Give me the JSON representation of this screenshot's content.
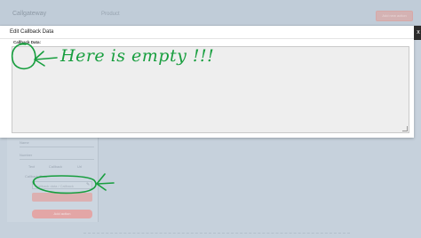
{
  "app": {
    "brand": "Callgateway",
    "page_heading": "Product",
    "top_button_label": "Add new action"
  },
  "background_form": {
    "field_1_label": "Name",
    "field_2_label": "Number",
    "tabs": [
      "Text",
      "Callback",
      "Url"
    ],
    "callback_label": "Callback Data",
    "callback_placeholder": "Callback data / Callback",
    "submit_label": "Add action"
  },
  "modal": {
    "title": "Edit Callback Data",
    "field_label": "Callback Data:",
    "textarea_value": "",
    "close_glyph": "x"
  },
  "annotation": {
    "text": "Here is empty !!!",
    "color": "#179e3e"
  },
  "colors": {
    "overlay": "#c6d1dc",
    "modal_bg": "#ffffff",
    "textarea_bg": "#eeeeee",
    "accent_red": "#e3a6a6"
  }
}
